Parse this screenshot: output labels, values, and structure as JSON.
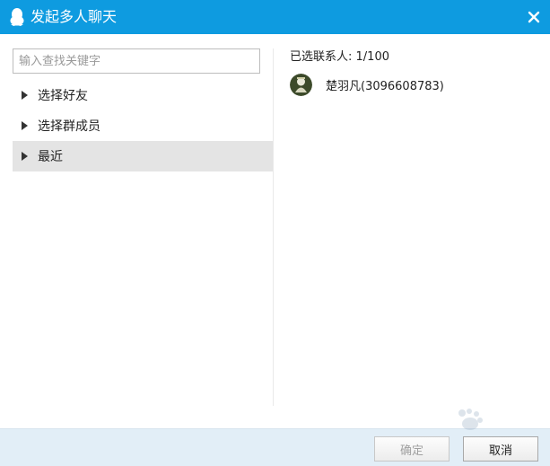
{
  "window": {
    "title": "发起多人聊天",
    "titlebar_color": "#0e9be0",
    "app_icon": "qq-penguin-icon",
    "close_icon": "close-icon"
  },
  "left_panel": {
    "search_placeholder": "输入查找关键字",
    "tree_items": [
      {
        "label": "选择好友",
        "selected": false
      },
      {
        "label": "选择群成员",
        "selected": false
      },
      {
        "label": "最近",
        "selected": true
      }
    ]
  },
  "right_panel": {
    "selected_label": "已选联系人:",
    "selected_count": "1/100",
    "contacts": [
      {
        "name": "楚羽凡(3096608783)",
        "avatar": "avatar-icon"
      }
    ]
  },
  "footer": {
    "confirm_label": "确定",
    "cancel_label": "取消"
  }
}
